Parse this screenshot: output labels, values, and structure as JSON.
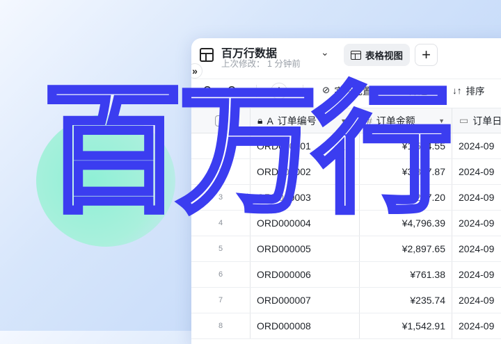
{
  "header": {
    "title": "百万行数据",
    "subtitle": "上次修改：  1 分钟前",
    "view_label": "表格视图",
    "add_view": "+",
    "expand": "»",
    "chevron": "⌄"
  },
  "toolbar": {
    "undo": "↶",
    "redo": "↷",
    "add": "+",
    "fields": "字段配置",
    "filter": "筛选",
    "sort": "排序"
  },
  "columns": [
    {
      "label": "订单编号"
    },
    {
      "label": "订单金额"
    },
    {
      "label": "订单日"
    }
  ],
  "rows": [
    {
      "n": "1",
      "id": "ORD000001",
      "amount": "¥1,584.55",
      "date": "2024-09"
    },
    {
      "n": "2",
      "id": "ORD000002",
      "amount": "¥3,897.87",
      "date": "2024-09"
    },
    {
      "n": "3",
      "id": "ORD000003",
      "amount": "¥287.20",
      "date": "2024-09"
    },
    {
      "n": "4",
      "id": "ORD000004",
      "amount": "¥4,796.39",
      "date": "2024-09"
    },
    {
      "n": "5",
      "id": "ORD000005",
      "amount": "¥2,897.65",
      "date": "2024-09"
    },
    {
      "n": "6",
      "id": "ORD000006",
      "amount": "¥761.38",
      "date": "2024-09"
    },
    {
      "n": "7",
      "id": "ORD000007",
      "amount": "¥235.74",
      "date": "2024-09"
    },
    {
      "n": "8",
      "id": "ORD000008",
      "amount": "¥1,542.91",
      "date": "2024-09"
    }
  ],
  "overlay_text": "百万行",
  "colors": {
    "accent": "#3b3df0",
    "mint": "#8ff0d6"
  }
}
